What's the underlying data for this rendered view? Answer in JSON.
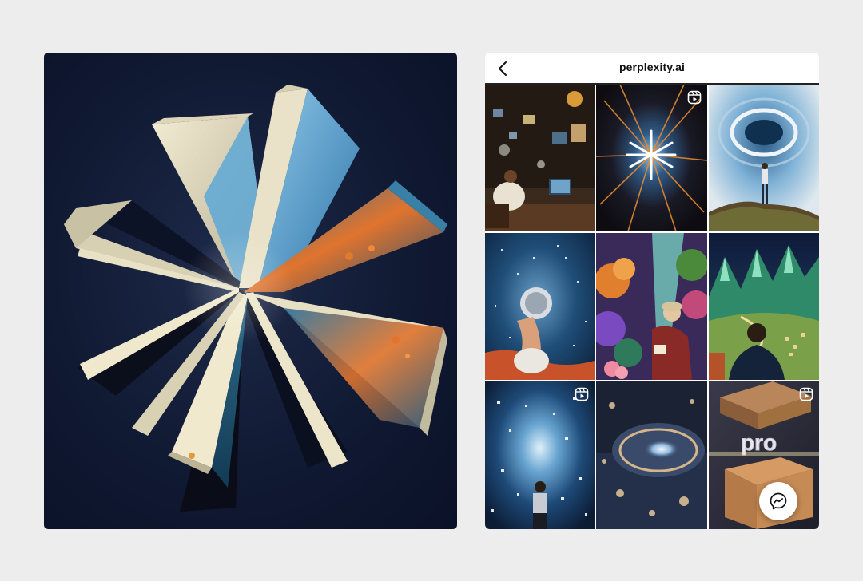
{
  "page": {
    "background": "#ededed"
  },
  "profile": {
    "title": "perplexity.ai"
  },
  "icons": {
    "back": "chevron-left-icon",
    "reel": "reels-icon",
    "messenger": "messenger-icon"
  },
  "grid": {
    "tiles": [
      {
        "subject": "man at computer desk with floating screens",
        "reel": false
      },
      {
        "subject": "starburst asterisk light",
        "reel": true
      },
      {
        "subject": "man on cliff facing swirling ring",
        "reel": false
      },
      {
        "subject": "hand holding glowing orb",
        "reel": false
      },
      {
        "subject": "man reading in colorful garden",
        "reel": false
      },
      {
        "subject": "man overlooking green valley",
        "reel": false
      },
      {
        "subject": "figure in sparkling light tunnel",
        "reel": true
      },
      {
        "subject": "glowing vortex over water",
        "reel": false
      },
      {
        "subject": "pro gift box",
        "reel": true,
        "label": "pro"
      }
    ]
  },
  "colors": {
    "accent_dark": "#111a33",
    "text": "#111111",
    "rule": "#222222"
  }
}
